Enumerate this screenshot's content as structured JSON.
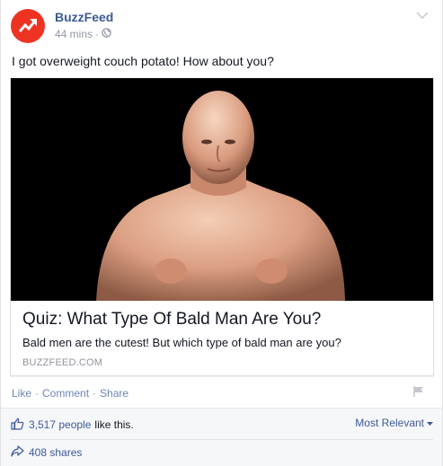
{
  "post": {
    "page_name": "BuzzFeed",
    "time": "44 mins",
    "privacy_separator": "·",
    "privacy_icon": "globe-icon",
    "status_text": "I got overweight couch potato! How about you?"
  },
  "link_card": {
    "image_subject": "man-photo",
    "title": "Quiz: What Type Of Bald Man Are You?",
    "description": "Bald men are the cutest! But which type of bald man are you?",
    "domain": "BUZZFEED.COM"
  },
  "actions": {
    "like": "Like",
    "comment": "Comment",
    "share": "Share",
    "separator": "·"
  },
  "ufi": {
    "likes_count": "3,517 people",
    "likes_rest": "like this.",
    "sort_label": "Most Relevant",
    "shares": "408 shares"
  },
  "colors": {
    "brand_red": "#ee3322",
    "link_blue": "#3b5998",
    "meta_gray": "#9197a3"
  }
}
